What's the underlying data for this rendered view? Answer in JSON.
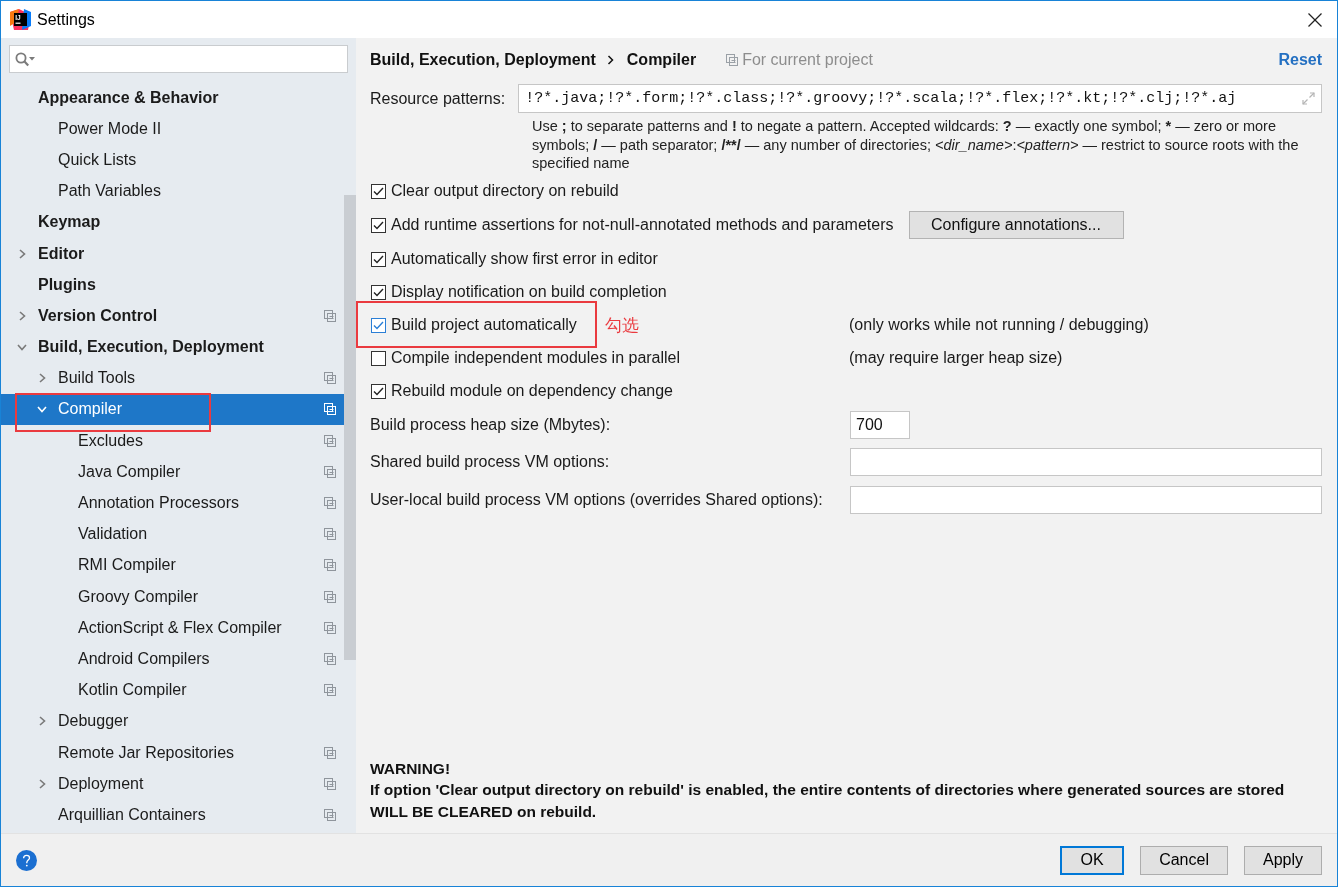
{
  "window": {
    "logo_text": "IJ",
    "title": "Settings"
  },
  "sidebar": {
    "items": [
      {
        "label": "Appearance & Behavior",
        "selected": false,
        "project_scoped": false,
        "highlighted": false,
        "children": [
          {
            "label": "Power Mode II",
            "selected": false,
            "project_scoped": false,
            "highlighted": false
          },
          {
            "label": "Quick Lists",
            "selected": false,
            "project_scoped": false,
            "highlighted": false
          },
          {
            "label": "Path Variables",
            "selected": false,
            "project_scoped": false,
            "highlighted": false
          }
        ]
      },
      {
        "label": "Keymap",
        "selected": false,
        "project_scoped": false,
        "highlighted": false
      },
      {
        "label": "Editor",
        "expanded": false,
        "selected": false,
        "project_scoped": false,
        "highlighted": false
      },
      {
        "label": "Plugins",
        "selected": false,
        "project_scoped": false,
        "highlighted": false
      },
      {
        "label": "Version Control",
        "expanded": false,
        "selected": false,
        "project_scoped": true,
        "highlighted": false
      },
      {
        "label": "Build, Execution, Deployment",
        "expanded": true,
        "selected": false,
        "project_scoped": false,
        "highlighted": false,
        "children": [
          {
            "label": "Build Tools",
            "expanded": false,
            "selected": false,
            "project_scoped": true,
            "highlighted": false
          },
          {
            "label": "Compiler",
            "expanded": true,
            "selected": true,
            "project_scoped": true,
            "highlighted": true,
            "children": [
              {
                "label": "Excludes",
                "selected": false,
                "project_scoped": true,
                "highlighted": false
              },
              {
                "label": "Java Compiler",
                "selected": false,
                "project_scoped": true,
                "highlighted": false
              },
              {
                "label": "Annotation Processors",
                "selected": false,
                "project_scoped": true,
                "highlighted": false
              },
              {
                "label": "Validation",
                "selected": false,
                "project_scoped": true,
                "highlighted": false
              },
              {
                "label": "RMI Compiler",
                "selected": false,
                "project_scoped": true,
                "highlighted": false
              },
              {
                "label": "Groovy Compiler",
                "selected": false,
                "project_scoped": true,
                "highlighted": false
              },
              {
                "label": "ActionScript & Flex Compiler",
                "selected": false,
                "project_scoped": true,
                "highlighted": false
              },
              {
                "label": "Android Compilers",
                "selected": false,
                "project_scoped": true,
                "highlighted": false
              },
              {
                "label": "Kotlin Compiler",
                "selected": false,
                "project_scoped": true,
                "highlighted": false
              }
            ]
          },
          {
            "label": "Debugger",
            "expanded": false,
            "selected": false,
            "project_scoped": false,
            "highlighted": false
          },
          {
            "label": "Remote Jar Repositories",
            "selected": false,
            "project_scoped": true,
            "highlighted": false
          },
          {
            "label": "Deployment",
            "expanded": false,
            "selected": false,
            "project_scoped": true,
            "highlighted": false
          },
          {
            "label": "Arquillian Containers",
            "selected": false,
            "project_scoped": true,
            "highlighted": false
          }
        ]
      }
    ]
  },
  "content": {
    "breadcrumb": [
      "Build, Execution, Deployment",
      "Compiler"
    ],
    "scope_note": "For current project",
    "reset_link": "Reset",
    "resource_patterns": {
      "label": "Resource patterns:",
      "value": "!?*.java;!?*.form;!?*.class;!?*.groovy;!?*.scala;!?*.flex;!?*.kt;!?*.clj;!?*.aj"
    },
    "hint": [
      {
        "text": "Use ",
        "kind": "plain"
      },
      {
        "text": ";",
        "kind": "bold"
      },
      {
        "text": " to separate patterns and ",
        "kind": "plain"
      },
      {
        "text": "!",
        "kind": "bold"
      },
      {
        "text": " to negate a pattern. Accepted wildcards: ",
        "kind": "plain"
      },
      {
        "text": "?",
        "kind": "bold"
      },
      {
        "text": " — exactly one symbol; ",
        "kind": "plain"
      },
      {
        "text": "*",
        "kind": "bold"
      },
      {
        "text": " — zero or more symbols; ",
        "kind": "plain"
      },
      {
        "text": "/",
        "kind": "bold"
      },
      {
        "text": " — path separator; ",
        "kind": "plain"
      },
      {
        "text": "/**/",
        "kind": "bold"
      },
      {
        "text": " — any number of directories; ",
        "kind": "plain"
      },
      {
        "text": "<dir_name>",
        "kind": "italic"
      },
      {
        "text": ":",
        "kind": "plain"
      },
      {
        "text": "<pattern>",
        "kind": "italic"
      },
      {
        "text": " — restrict to source roots with the specified name",
        "kind": "plain"
      }
    ],
    "options": [
      {
        "label": "Clear output directory on rebuild",
        "checked": true,
        "focused": false,
        "highlighted": false
      },
      {
        "label": "Add runtime assertions for not-null-annotated methods and parameters",
        "checked": true,
        "focused": false,
        "highlighted": false,
        "button": "Configure annotations..."
      },
      {
        "label": "Automatically show first error in editor",
        "checked": true,
        "focused": false,
        "highlighted": false
      },
      {
        "label": "Display notification on build completion",
        "checked": true,
        "focused": false,
        "highlighted": false
      },
      {
        "label": "Build project automatically",
        "checked": true,
        "focused": true,
        "highlighted": true,
        "annotation": "勾选",
        "note": "(only works while not running / debugging)"
      },
      {
        "label": "Compile independent modules in parallel",
        "checked": false,
        "focused": false,
        "highlighted": false,
        "note": "(may require larger heap size)"
      },
      {
        "label": "Rebuild module on dependency change",
        "checked": true,
        "focused": false,
        "highlighted": false
      }
    ],
    "fields": [
      {
        "label": "Build process heap size (Mbytes):",
        "value": "700",
        "kind": "short"
      },
      {
        "label": "Shared build process VM options:",
        "kind": "wide"
      },
      {
        "label": "User-local build process VM options (overrides Shared options):",
        "kind": "wide"
      }
    ],
    "warning": {
      "title": "WARNING!",
      "text": "If option 'Clear output directory on rebuild' is enabled, the entire contents of directories where generated sources are stored WILL BE CLEARED on rebuild."
    }
  },
  "footer": {
    "buttons": [
      {
        "label": "OK",
        "default": true
      },
      {
        "label": "Cancel",
        "default": false
      },
      {
        "label": "Apply",
        "default": false
      }
    ]
  }
}
